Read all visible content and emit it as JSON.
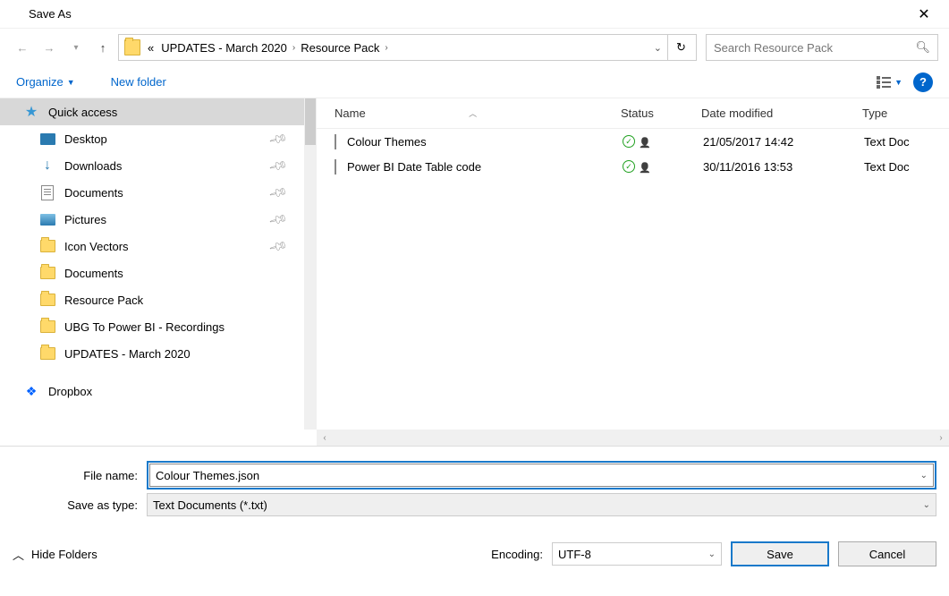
{
  "title": "Save As",
  "breadcrumb": {
    "prefix": "«",
    "items": [
      "UPDATES - March 2020",
      "Resource Pack"
    ]
  },
  "search": {
    "placeholder": "Search Resource Pack"
  },
  "toolbar": {
    "organize": "Organize",
    "newfolder": "New folder"
  },
  "sidebar": {
    "quick_access": "Quick access",
    "items": [
      {
        "label": "Desktop",
        "pinned": true,
        "icon": "desktop"
      },
      {
        "label": "Downloads",
        "pinned": true,
        "icon": "download"
      },
      {
        "label": "Documents",
        "pinned": true,
        "icon": "doc"
      },
      {
        "label": "Pictures",
        "pinned": true,
        "icon": "pic"
      },
      {
        "label": "Icon Vectors",
        "pinned": true,
        "icon": "folder"
      },
      {
        "label": "Documents",
        "pinned": false,
        "icon": "folder"
      },
      {
        "label": "Resource Pack",
        "pinned": false,
        "icon": "folder"
      },
      {
        "label": "UBG To Power BI - Recordings",
        "pinned": false,
        "icon": "folder"
      },
      {
        "label": "UPDATES - March 2020",
        "pinned": false,
        "icon": "folder"
      }
    ],
    "dropbox": "Dropbox"
  },
  "columns": {
    "name": "Name",
    "status": "Status",
    "date": "Date modified",
    "type": "Type"
  },
  "files": [
    {
      "name": "Colour Themes",
      "date": "21/05/2017 14:42",
      "type": "Text Doc"
    },
    {
      "name": "Power BI Date Table code",
      "date": "30/11/2016 13:53",
      "type": "Text Doc"
    }
  ],
  "filename": {
    "label": "File name:",
    "value": "Colour Themes.json"
  },
  "savetype": {
    "label": "Save as type:",
    "value": "Text Documents (*.txt)"
  },
  "encoding": {
    "label": "Encoding:",
    "value": "UTF-8"
  },
  "hide_folders": "Hide Folders",
  "buttons": {
    "save": "Save",
    "cancel": "Cancel"
  }
}
